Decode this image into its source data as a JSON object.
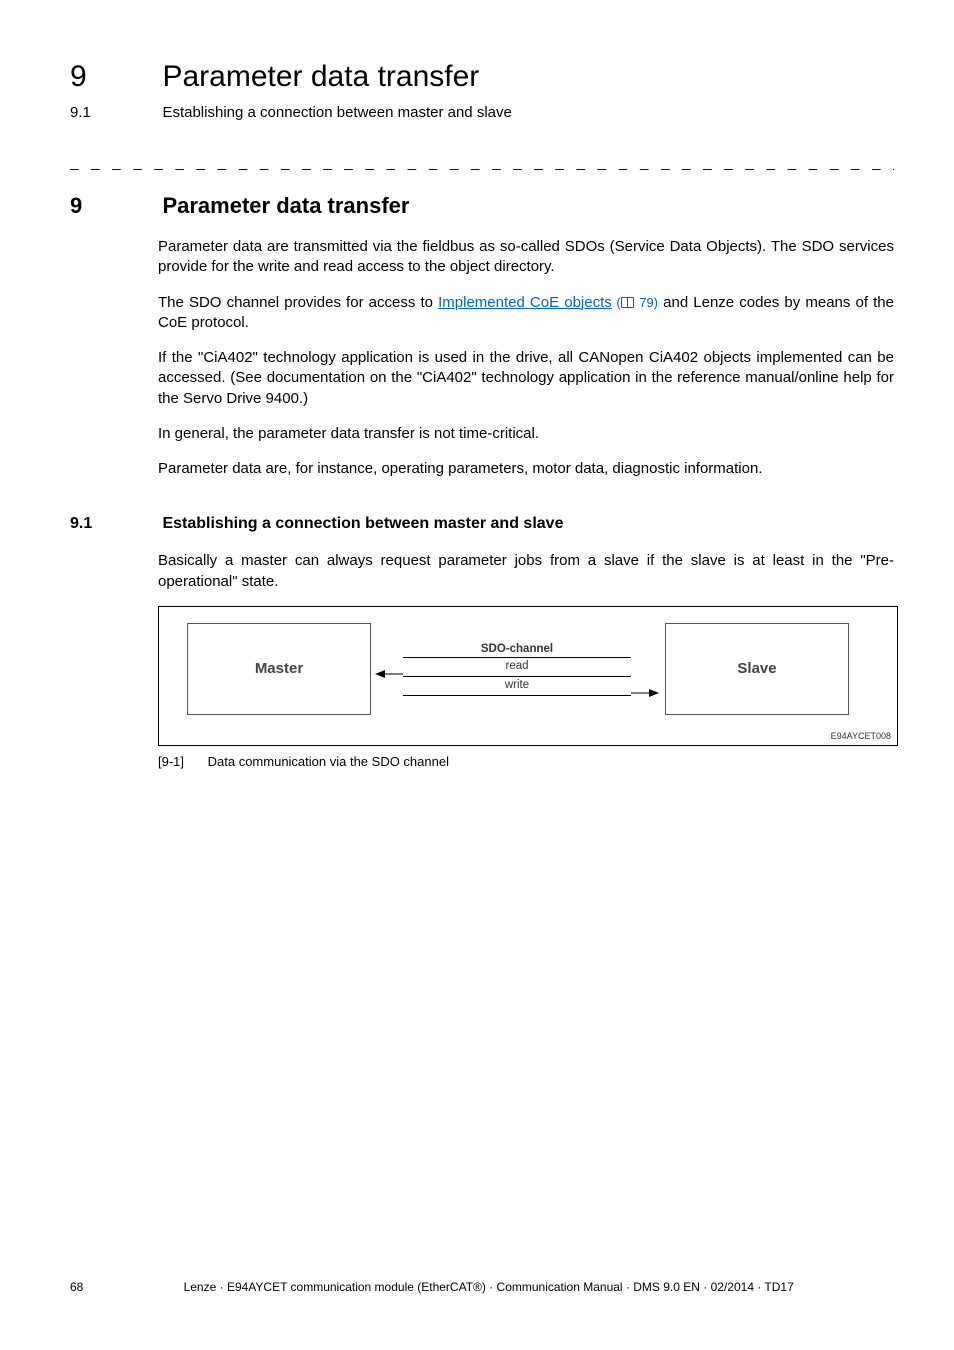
{
  "header": {
    "chapter_number": "9",
    "chapter_title": "Parameter data transfer",
    "section_number": "9.1",
    "section_title": "Establishing a connection between master and slave"
  },
  "separator": "_ _ _ _ _ _ _ _ _ _ _ _ _ _ _ _ _ _ _ _ _ _ _ _ _ _ _ _ _ _ _ _ _ _ _ _ _ _ _ _ _ _ _ _ _ _ _ _ _ _ _ _ _ _ _ _ _ _ _ _ _ _ _ _",
  "main_section": {
    "number": "9",
    "title": "Parameter data transfer"
  },
  "body": {
    "p1": "Parameter data are transmitted via the fieldbus as so-called SDOs (Service Data Objects). The SDO services provide for the write and read access to the object directory.",
    "p2a": "The SDO channel provides for access to ",
    "p2_link_text": "Implemented CoE objects",
    "p2_pageref_prefix": " (",
    "p2_pageref_num": " 79)",
    "p2b": " and Lenze codes by means of the CoE protocol.",
    "p3": "If the \"CiA402\" technology application is used in the drive, all CANopen CiA402 objects implemented can be accessed. (See documentation on the \"CiA402\" technology application in the reference manual/online help for the Servo Drive 9400.)",
    "p4": "In general, the parameter data transfer is not time-critical.",
    "p5": "Parameter data are, for instance, operating parameters, motor data, diagnostic information."
  },
  "subsection": {
    "number": "9.1",
    "title": "Establishing a connection between master and slave",
    "p1": "Basically a master can always request parameter jobs from a slave if the slave is at least in the \"Pre-operational\" state."
  },
  "diagram": {
    "master_label": "Master",
    "slave_label": "Slave",
    "channel_title": "SDO-channel",
    "read_label": "read",
    "write_label": "write",
    "frame_code": "E94AYCET008"
  },
  "figure": {
    "number": "[9-1]",
    "caption": "Data communication via the SDO channel"
  },
  "footer": {
    "page_number": "68",
    "text": "Lenze · E94AYCET communication module (EtherCAT®) · Communication Manual · DMS 9.0 EN · 02/2014 · TD17"
  }
}
